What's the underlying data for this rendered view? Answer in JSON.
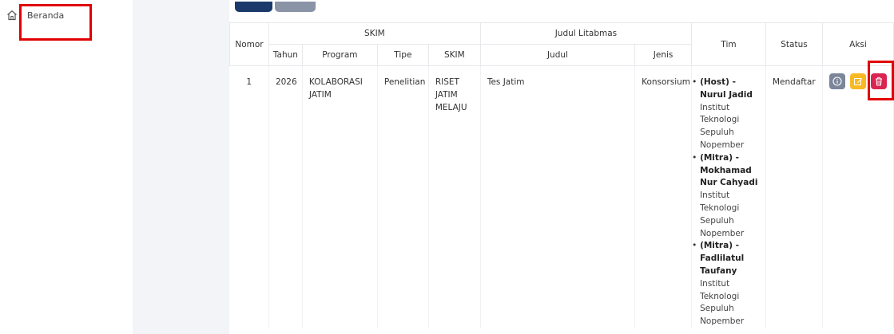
{
  "sidebar": {
    "items": [
      {
        "label": "Beranda",
        "icon": "home-icon"
      }
    ]
  },
  "table": {
    "group_headers": {
      "nomor": "Nomor",
      "skim": "SKIM",
      "judul_litabmas": "Judul Litabmas",
      "tim": "Tim",
      "status": "Status",
      "aksi": "Aksi"
    },
    "sub_headers": {
      "tahun": "Tahun",
      "program": "Program",
      "tipe": "Tipe",
      "skim": "SKIM",
      "judul": "Judul",
      "jenis": "Jenis"
    },
    "rows": [
      {
        "nomor": "1",
        "tahun": "2026",
        "program": "KOLABORASI JATIM",
        "tipe": "Penelitian",
        "skim": "RISET JATIM MELAJU",
        "judul": "Tes Jatim",
        "jenis": "Konsorsium",
        "tim": [
          {
            "role_name": "(Host) - Nurul Jadid",
            "institution": "Institut Teknologi Sepuluh Nopember"
          },
          {
            "role_name": "(Mitra) - Mokhamad Nur Cahyadi",
            "institution": "Institut Teknologi Sepuluh Nopember"
          },
          {
            "role_name": "(Mitra) - Fadlilatul Taufany",
            "institution": "Institut Teknologi Sepuluh Nopember"
          }
        ],
        "status": "Mendaftar",
        "actions": [
          {
            "icon": "info-icon",
            "color": "#7b869a"
          },
          {
            "icon": "edit-icon",
            "color": "#f7b924"
          },
          {
            "icon": "trash-icon",
            "color": "#d92550"
          }
        ]
      }
    ]
  },
  "colors": {
    "primary_button": "#1b3a6b",
    "secondary_button": "#8a94a6",
    "highlight": "#e10000"
  }
}
